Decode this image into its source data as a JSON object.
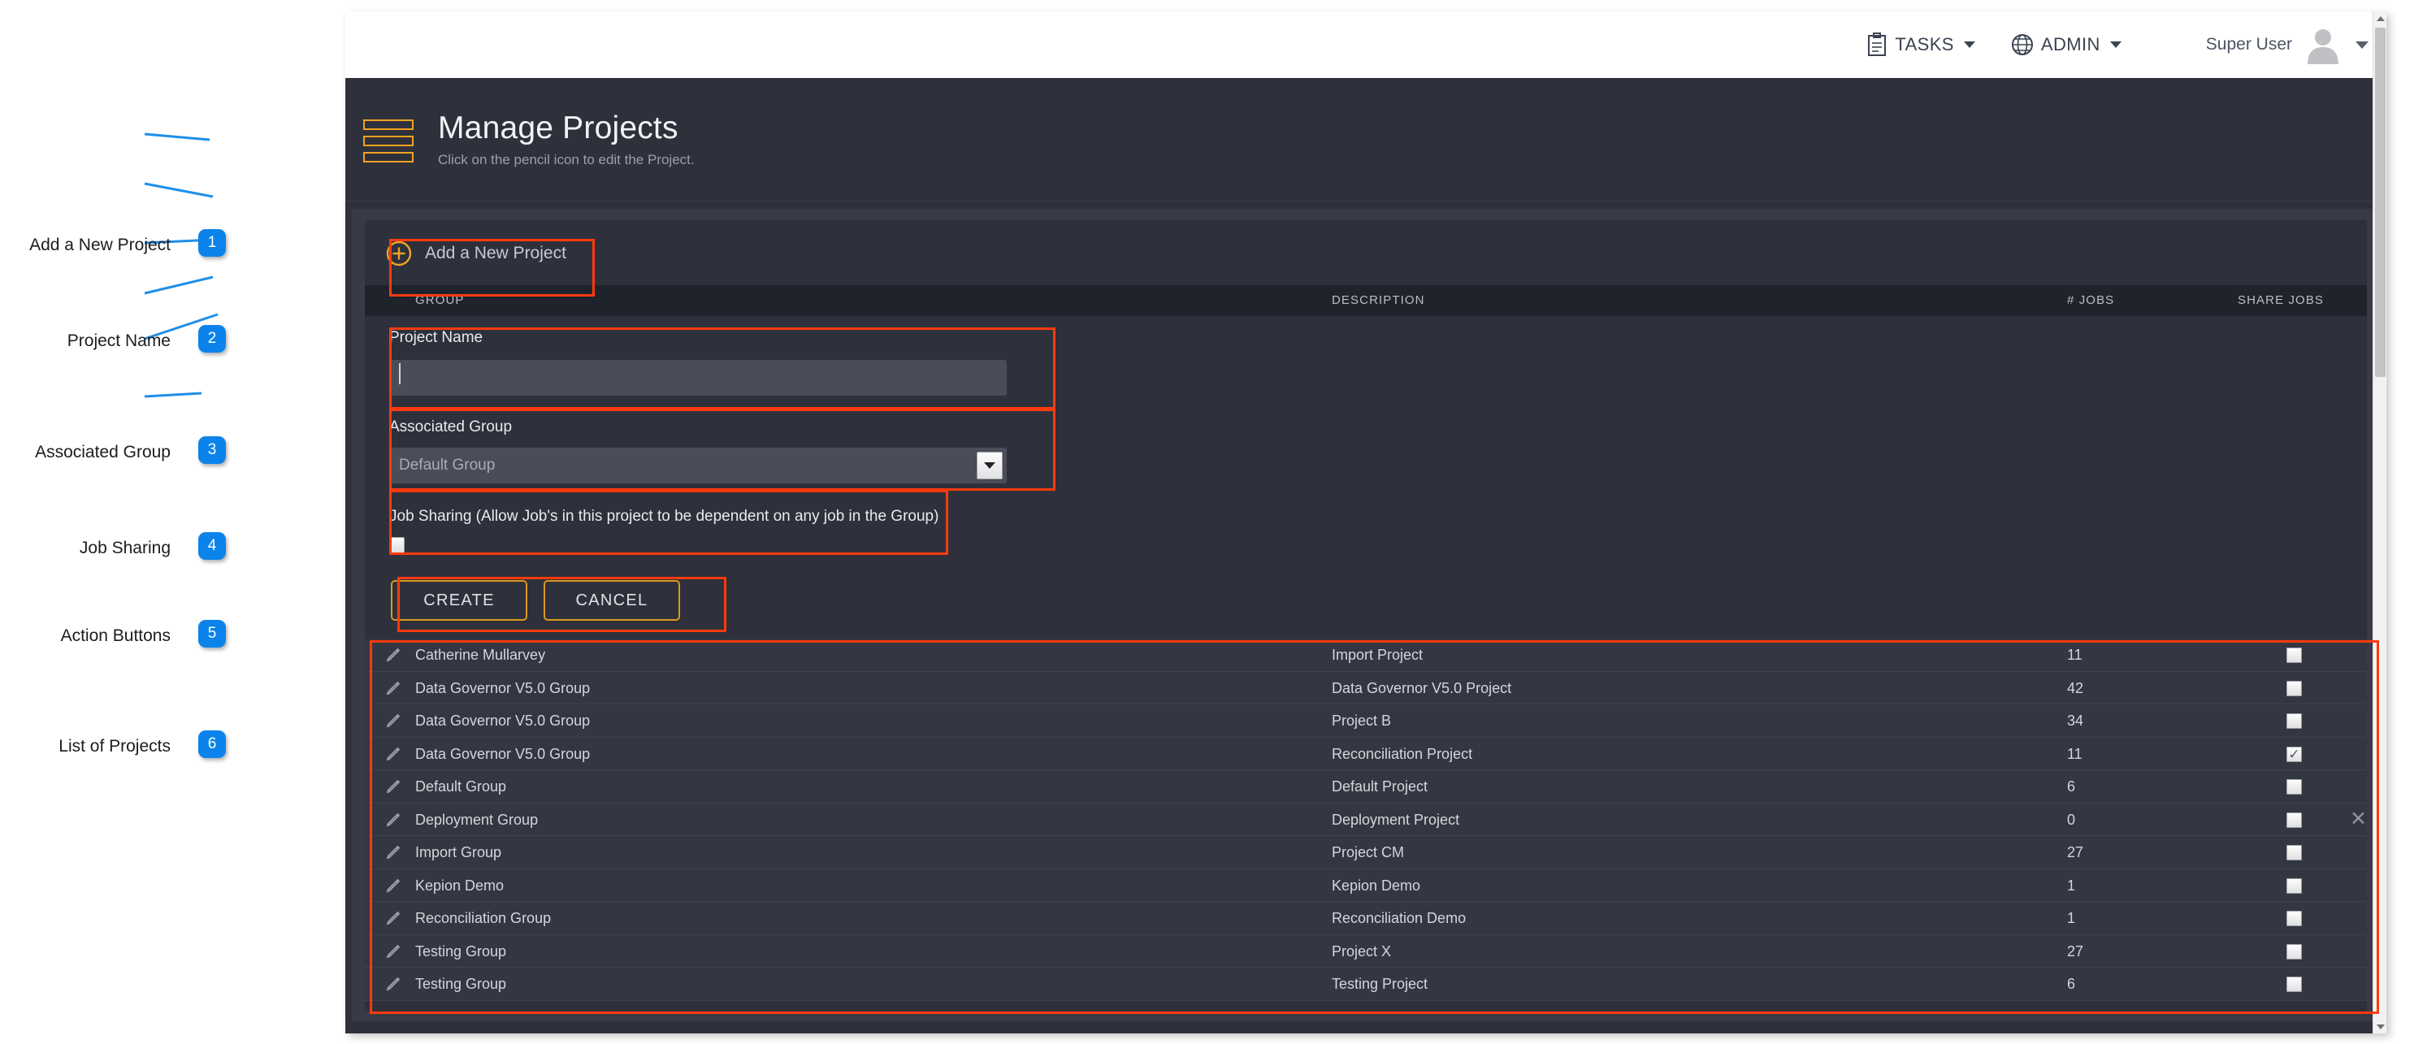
{
  "topbar": {
    "nav": [
      {
        "label": "TASKS",
        "icon": "clipboard-icon"
      },
      {
        "label": "ADMIN",
        "icon": "globe-icon"
      }
    ],
    "user_name": "Super User",
    "avatar_icon": "user-avatar-icon",
    "user_caret_icon": "chevron-down-icon"
  },
  "header": {
    "menu_icon": "hamburger-icon",
    "title": "Manage Projects",
    "subtitle": "Click on the pencil icon to edit the Project."
  },
  "add_project": {
    "icon": "circle-plus-icon",
    "label": "Add a New Project"
  },
  "table": {
    "columns": [
      "GROUP",
      "DESCRIPTION",
      "# JOBS",
      "SHARE JOBS"
    ],
    "rows": [
      {
        "group": "Catherine Mullarvey",
        "description": "Import Project",
        "jobs": "11",
        "share": false,
        "deletable": false
      },
      {
        "group": "Data Governor V5.0 Group",
        "description": "Data Governor V5.0 Project",
        "jobs": "42",
        "share": false,
        "deletable": false
      },
      {
        "group": "Data Governor V5.0 Group",
        "description": "Project B",
        "jobs": "34",
        "share": false,
        "deletable": false
      },
      {
        "group": "Data Governor V5.0 Group",
        "description": "Reconciliation Project",
        "jobs": "11",
        "share": true,
        "deletable": false
      },
      {
        "group": "Default Group",
        "description": "Default Project",
        "jobs": "6",
        "share": false,
        "deletable": false
      },
      {
        "group": "Deployment Group",
        "description": "Deployment Project",
        "jobs": "0",
        "share": false,
        "deletable": true
      },
      {
        "group": "Import Group",
        "description": "Project CM",
        "jobs": "27",
        "share": false,
        "deletable": false
      },
      {
        "group": "Kepion Demo",
        "description": "Kepion Demo",
        "jobs": "1",
        "share": false,
        "deletable": false
      },
      {
        "group": "Reconciliation Group",
        "description": "Reconciliation Demo",
        "jobs": "1",
        "share": false,
        "deletable": false
      },
      {
        "group": "Testing Group",
        "description": "Project X",
        "jobs": "27",
        "share": false,
        "deletable": false
      },
      {
        "group": "Testing Group",
        "description": "Testing Project",
        "jobs": "6",
        "share": false,
        "deletable": false
      }
    ],
    "delete_icon": "close-x-icon",
    "edit_icon": "pencil-icon"
  },
  "form": {
    "project_name_label": "Project Name",
    "project_name_value": "",
    "project_name_placeholder": "",
    "associated_group_label": "Associated Group",
    "associated_group_value": "Default Group",
    "associated_group_options": [
      "Default Group"
    ],
    "job_sharing_label": "Job Sharing (Allow Job's in this project to be dependent on any job in the Group)",
    "job_sharing_checked": false,
    "create_label": "CREATE",
    "cancel_label": "CANCEL"
  },
  "annotations": [
    {
      "number": "1",
      "label": "Add a New Project"
    },
    {
      "number": "2",
      "label": "Project Name"
    },
    {
      "number": "3",
      "label": "Associated Group"
    },
    {
      "number": "4",
      "label": "Job Sharing"
    },
    {
      "number": "5",
      "label": "Action Buttons"
    },
    {
      "number": "6",
      "label": "List of Projects"
    }
  ],
  "colors": {
    "accent_orange": "#f0a323",
    "annotation_red": "#ff3a0f",
    "badge_blue": "#0c83ea",
    "panel_bg": "#2e313b",
    "row_bg": "#333741"
  }
}
